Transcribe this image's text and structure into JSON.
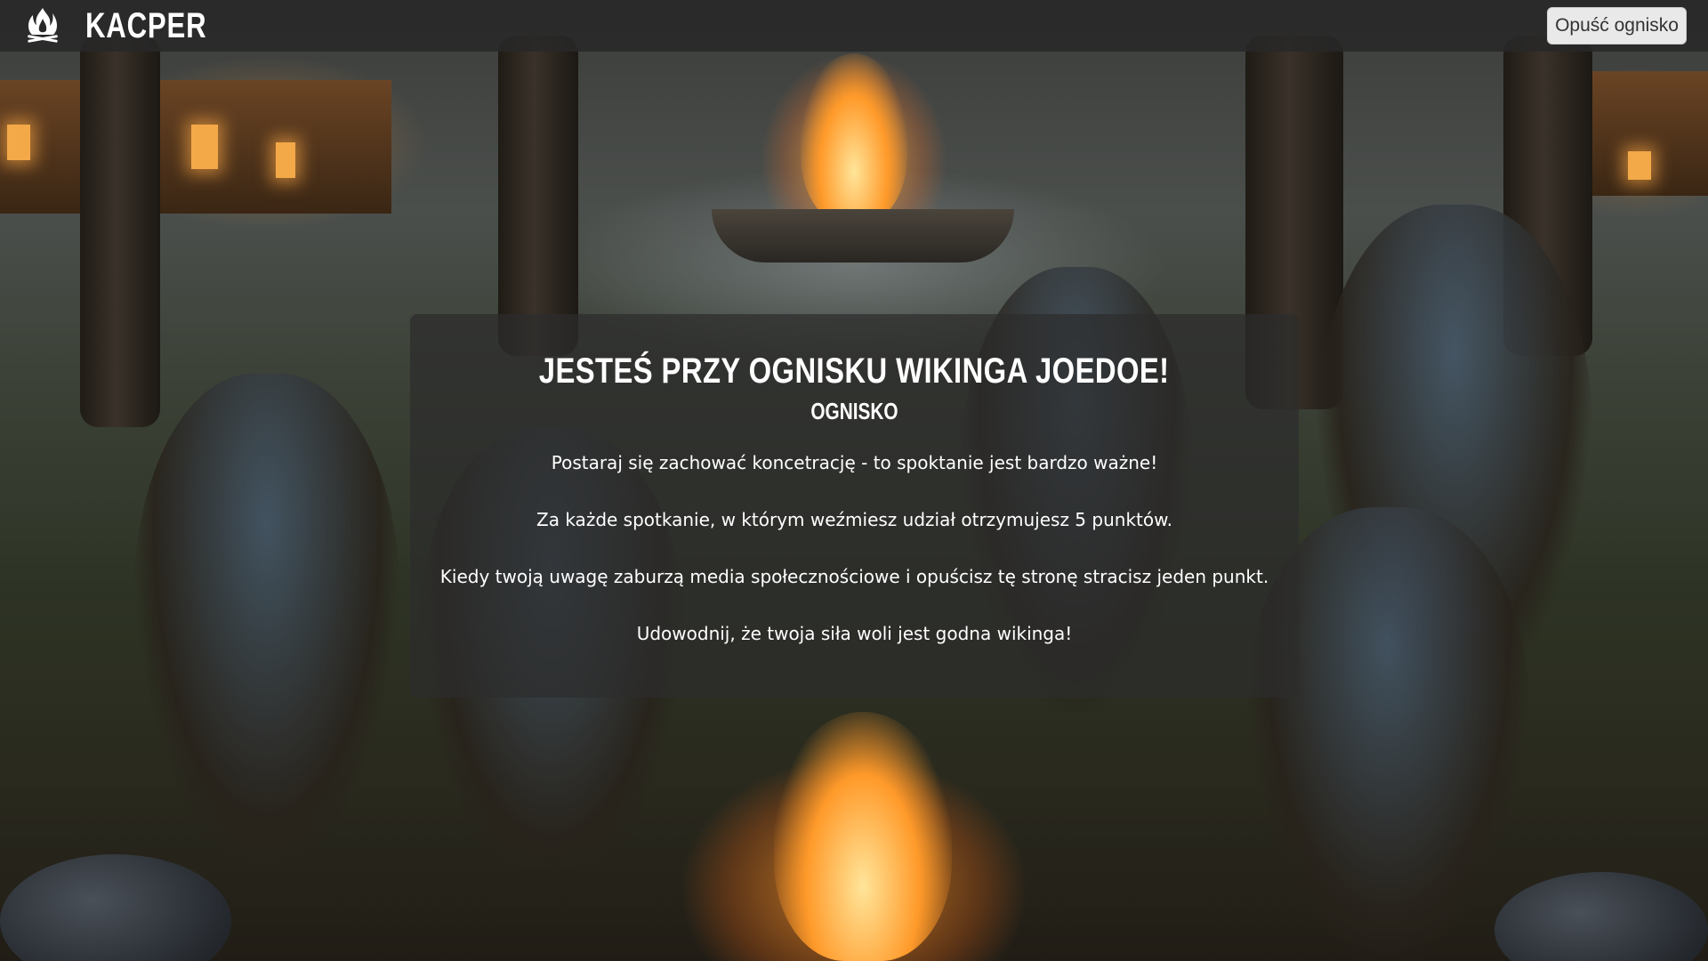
{
  "app": {
    "brand_name": "KACPER",
    "brand_icon": "campfire-icon"
  },
  "header": {
    "leave_button_label": "Opuść ognisko"
  },
  "panel": {
    "title": "Jesteś przy ognisku wikinga joedoe!",
    "subtitle": "Ognisko",
    "lines": [
      "Postaraj się zachować koncetrację - to spoktanie jest bardzo ważne!",
      "Za każde spotkanie, w którym weźmiesz udział otrzymujesz 5 punktów.",
      "Kiedy twoją uwagę zaburzą media społecznościowe i opuścisz tę stronę stracisz jeden punkt.",
      "Udowodnij, że twoja siła woli jest godna wikinga!"
    ]
  },
  "colors": {
    "topbar_bg": "#282828",
    "panel_bg": "#2d2d2d",
    "button_bg": "#e9e9e9",
    "text": "#ffffff"
  }
}
